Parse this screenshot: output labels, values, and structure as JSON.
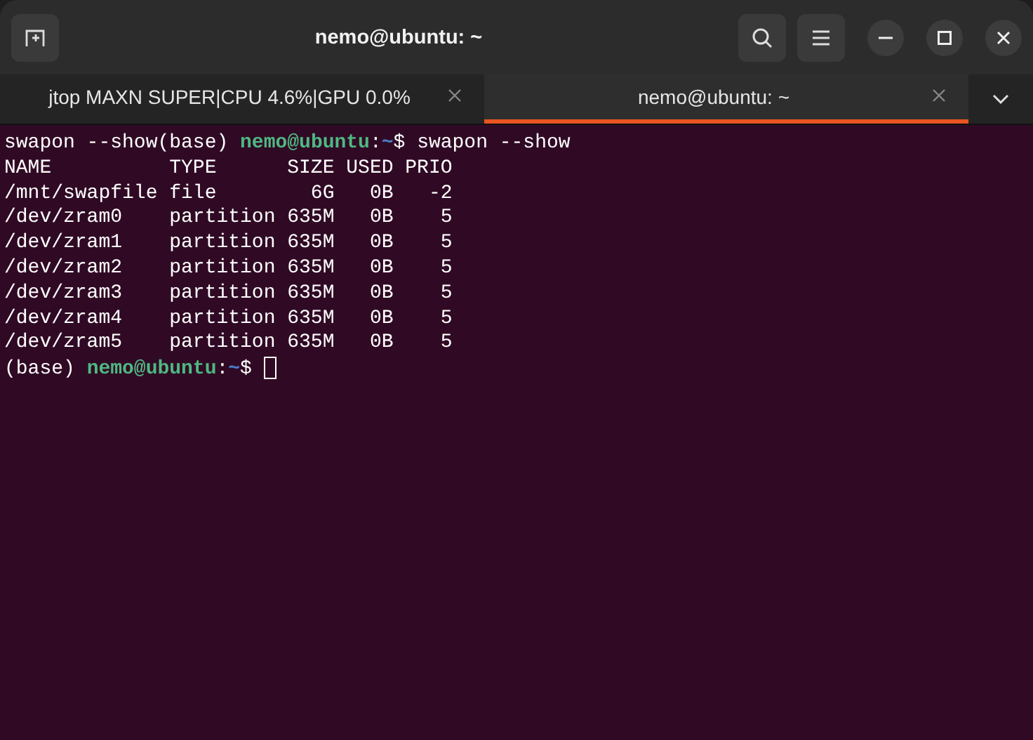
{
  "window": {
    "title": "nemo@ubuntu: ~"
  },
  "tabs": [
    {
      "label": "jtop MAXN SUPER|CPU 4.6%|GPU 0.0%",
      "selected": false
    },
    {
      "label": "nemo@ubuntu: ~",
      "selected": true
    }
  ],
  "terminal": {
    "lines": [
      {
        "segments": [
          {
            "kind": "plain",
            "text": "swapon --show(base) "
          },
          {
            "kind": "user",
            "text": "nemo@ubuntu"
          },
          {
            "kind": "plain",
            "text": ":"
          },
          {
            "kind": "path",
            "text": "~"
          },
          {
            "kind": "plain",
            "text": "$ swapon --show"
          }
        ],
        "cursor": false
      },
      {
        "segments": [
          {
            "kind": "plain",
            "text": "NAME          TYPE      SIZE USED PRIO"
          }
        ],
        "cursor": false
      },
      {
        "segments": [
          {
            "kind": "plain",
            "text": "/mnt/swapfile file        6G   0B   -2"
          }
        ],
        "cursor": false
      },
      {
        "segments": [
          {
            "kind": "plain",
            "text": "/dev/zram0    partition 635M   0B    5"
          }
        ],
        "cursor": false
      },
      {
        "segments": [
          {
            "kind": "plain",
            "text": "/dev/zram1    partition 635M   0B    5"
          }
        ],
        "cursor": false
      },
      {
        "segments": [
          {
            "kind": "plain",
            "text": "/dev/zram2    partition 635M   0B    5"
          }
        ],
        "cursor": false
      },
      {
        "segments": [
          {
            "kind": "plain",
            "text": "/dev/zram3    partition 635M   0B    5"
          }
        ],
        "cursor": false
      },
      {
        "segments": [
          {
            "kind": "plain",
            "text": "/dev/zram4    partition 635M   0B    5"
          }
        ],
        "cursor": false
      },
      {
        "segments": [
          {
            "kind": "plain",
            "text": "/dev/zram5    partition 635M   0B    5"
          }
        ],
        "cursor": false
      },
      {
        "segments": [
          {
            "kind": "plain",
            "text": "(base) "
          },
          {
            "kind": "user",
            "text": "nemo@ubuntu"
          },
          {
            "kind": "plain",
            "text": ":"
          },
          {
            "kind": "path",
            "text": "~"
          },
          {
            "kind": "plain",
            "text": "$ "
          }
        ],
        "cursor": true
      }
    ]
  }
}
